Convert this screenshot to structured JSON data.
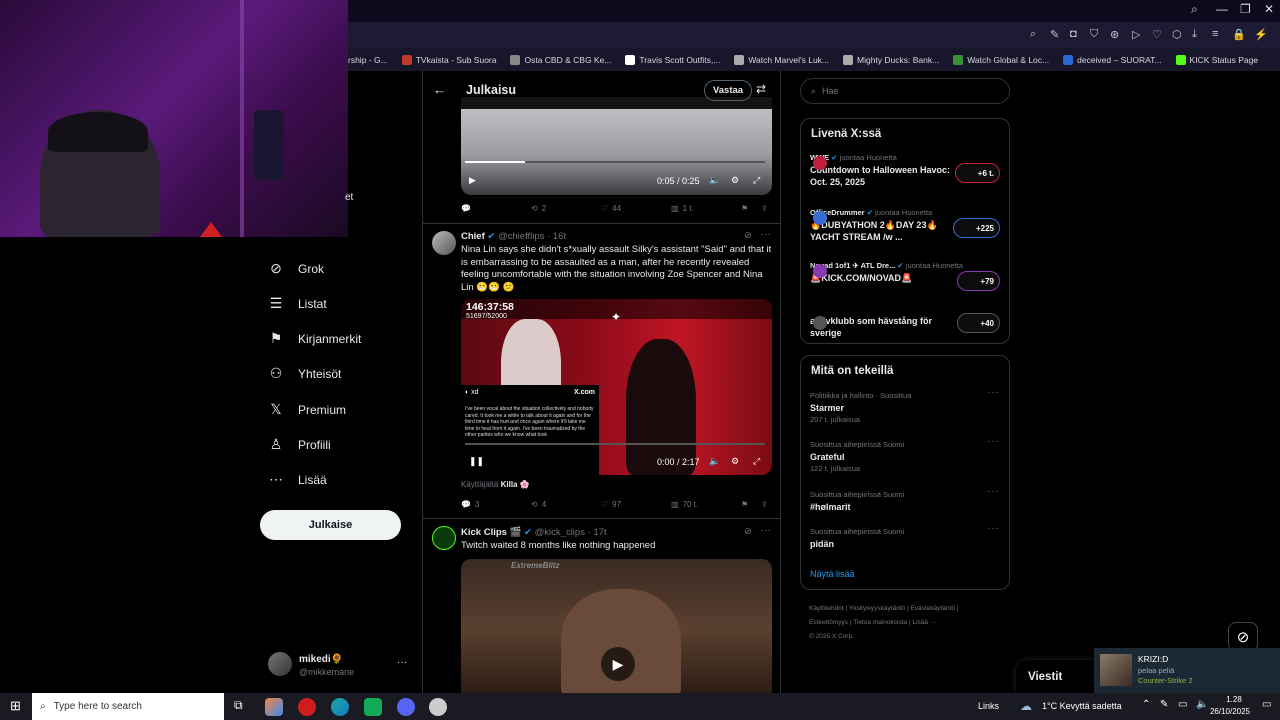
{
  "browser": {
    "bookmarks": [
      {
        "label": "rship - G...",
        "color": "#555"
      },
      {
        "label": "TVkaista - Sub Suora",
        "color": "#c0392b"
      },
      {
        "label": "Osta CBD & CBG Ke...",
        "color": "#888"
      },
      {
        "label": "Travis Scott Outfits,...",
        "color": "#fff"
      },
      {
        "label": "Watch Marvel's Luk...",
        "color": "#aaa"
      },
      {
        "label": "Mighty Ducks: Bank...",
        "color": "#aaa"
      },
      {
        "label": "Watch Global & Loc...",
        "color": "#3a8f3a"
      },
      {
        "label": "deceived – SUORAT...",
        "color": "#2a6ad4"
      },
      {
        "label": "KICK Status Page",
        "color": "#53fc18"
      }
    ]
  },
  "nav": {
    "partial_top": "et",
    "items": [
      {
        "label": "Grok",
        "icon": "grok-icon",
        "glyph": "⊘"
      },
      {
        "label": "Listat",
        "icon": "lists-icon",
        "glyph": "☰"
      },
      {
        "label": "Kirjanmerkit",
        "icon": "bookmark-icon",
        "glyph": "⚑"
      },
      {
        "label": "Yhteisöt",
        "icon": "communities-icon",
        "glyph": "⚇"
      },
      {
        "label": "Premium",
        "icon": "x-logo-icon",
        "glyph": "𝕏"
      },
      {
        "label": "Profiili",
        "icon": "profile-icon",
        "glyph": "♙"
      },
      {
        "label": "Lisää",
        "icon": "more-icon",
        "glyph": "⋯"
      }
    ],
    "post_button": "Julkaise",
    "account": {
      "name": "mikedi",
      "handle": "@mikkemane",
      "more": "···"
    }
  },
  "header": {
    "title": "Julkaisu",
    "reply_button": "Vastaa",
    "back": "←",
    "settings": "⇄"
  },
  "top_video": {
    "time": "0:05 / 0:25",
    "actions": {
      "replies": "",
      "reposts": "2",
      "likes": "44",
      "views": "1 t."
    }
  },
  "tweet1": {
    "name": "Chief",
    "handle": "@chiefflips · 16t",
    "text": "Nina Lin says she didn't s*xually assault Silky's assistant \"Said\" and that it is embarrassing to be assaulted as a man, after he recently revealed feeling uncomfortable with the situation involving Zoe Spencer and Nina Lin 😬😬 😕",
    "overlay_time": "146:37:58",
    "overlay_count": "51697/52000",
    "embed_logo": "X.com",
    "embed_text": "I've been vocal about the situation collectively and nobody cared. It took me a while to talk about it again and for the third time it has hurt and once again where it'll take me time to heal from it again. I've been traumatized by the other parties who we know what took",
    "video_time": "0:00 / 2:17",
    "via_prefix": "Käyttäjältä",
    "via_user": "Killa 🌸",
    "actions": {
      "replies": "3",
      "reposts": "4",
      "likes": "97",
      "views": "70 t."
    }
  },
  "tweet2": {
    "name": "Kick Clips 🎬",
    "handle": "@kick_clips · 17t",
    "text": "Twitch waited 8 months like nothing happened",
    "watermark": "ExtremeBlitz"
  },
  "search": {
    "placeholder": "Hae"
  },
  "live": {
    "title": "Livenä X:ssä",
    "items": [
      {
        "host": "WWE",
        "suffix": "juontaa Huonetta",
        "title": "Countdown to Halloween Havoc: Oct. 25, 2025",
        "count": "+6 t."
      },
      {
        "host": "OfficeDrummer",
        "suffix": "juontaa Huonetta",
        "title": "🔥DUBYATHON 2🔥DAY 23🔥 YACHT STREAM /w ...",
        "count": "+225"
      },
      {
        "host": "Novad 1of1 ✈ ATL Dre...",
        "suffix": "juontaa Huonetta",
        "title": "🚨KICK.COM/NOVAD🚨",
        "count": "+79"
      },
      {
        "host": "",
        "suffix": "",
        "title": "aktivklubb som hävstång för sverige",
        "count": "+40"
      }
    ]
  },
  "trends": {
    "title": "Mitä on tekeillä",
    "items": [
      {
        "context": "Politiikka ja hallinto · Suosittua",
        "name": "Starmer",
        "count": "207 t. julkaisua"
      },
      {
        "context": "Suosittua aihepiirissä Suomi",
        "name": "Grateful",
        "count": "122 t. julkaisua"
      },
      {
        "context": "Suosittua aihepiirissä Suomi",
        "name": "#hølmarit",
        "count": ""
      },
      {
        "context": "Suosittua aihepiirissä Suomi",
        "name": "pidän",
        "count": ""
      }
    ],
    "show_more": "Näytä lisää"
  },
  "footer": {
    "line1": [
      "Käyttöehdot",
      "Yksityisyyskäytäntö",
      "Evästekäytäntö"
    ],
    "line2": [
      "Esteettömyys",
      "Tietoa mainoksista",
      "Lisää ···"
    ],
    "copyright": "© 2025 X Corp."
  },
  "messages": {
    "label": "Viestit"
  },
  "notification": {
    "name": "KRIZI:D",
    "status": "pelaa peliä",
    "game": "Counter-Strike 2"
  },
  "taskbar": {
    "search_placeholder": "Type here to search",
    "links": "Links",
    "weather": "1°C  Kevyttä sadetta",
    "time": "1.28",
    "date": "26/10/2025"
  },
  "colors": {
    "accent": "#1d9bf0",
    "kick_green": "#53fc18",
    "live_red": "#f91880"
  }
}
